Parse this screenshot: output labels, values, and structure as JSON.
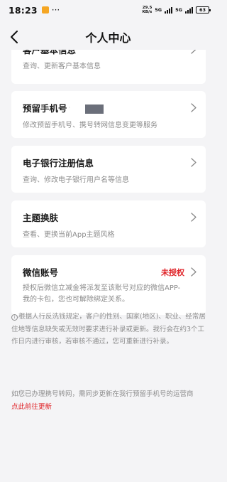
{
  "status_bar": {
    "time": "18:23",
    "more": "···",
    "net_speed_top": "29.5",
    "net_speed_unit": "KB/s",
    "net_type_1": "5G",
    "net_type_2": "5G",
    "battery": "63"
  },
  "header": {
    "title": "个人中心"
  },
  "cards": [
    {
      "title": "客户基本信息",
      "desc": "查询、更新客户基本信息"
    },
    {
      "title": "预留手机号",
      "desc": "修改预留手机号、携号转网信息变更等服务"
    },
    {
      "title": "电子银行注册信息",
      "desc": "查询、修改电子银行用户名等信息"
    },
    {
      "title": "主题换肤",
      "desc": "查看、更换当前App主题风格"
    },
    {
      "title": "微信账号",
      "status": "未授权",
      "desc": "授权后微信立减金将派发至该账号对应的微信APP-我的卡包，您也可解除绑定关系。"
    }
  ],
  "notice": {
    "text": "根据人行反洗钱规定，客户的性别、国家(地区)、职业、经常居住地等信息缺失或无效时要求进行补录或更新。我行会在约3个工作日内进行审核，若审核不通过，您可重新进行补录。"
  },
  "tip": {
    "text": "如您已办理携号转网，需同步更新在我行预留手机号的运营商",
    "link": "点此前往更新"
  },
  "colors": {
    "accent_red": "#e0262b",
    "background": "#f4f4f6"
  }
}
